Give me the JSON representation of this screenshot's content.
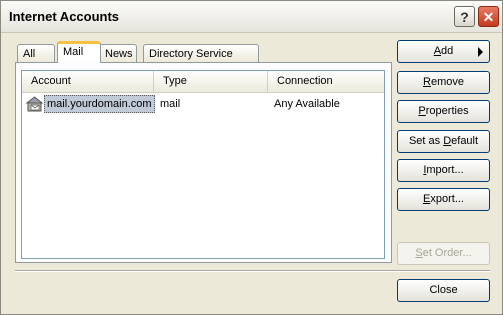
{
  "window": {
    "title": "Internet Accounts"
  },
  "titlebar": {
    "help_glyph": "?",
    "close_glyph": "✕"
  },
  "tabs": [
    {
      "label": "All"
    },
    {
      "label": "Mail",
      "active": true
    },
    {
      "label": "News"
    },
    {
      "label": "Directory Service"
    }
  ],
  "list": {
    "columns": [
      "Account",
      "Type",
      "Connection"
    ],
    "rows": [
      {
        "account": "mail.yourdomain.com",
        "type": "mail",
        "connection": "Any Available",
        "icon": "mail-account-icon"
      }
    ]
  },
  "buttons": {
    "add": {
      "mnemonic": "A",
      "rest": "dd"
    },
    "remove": {
      "mnemonic": "R",
      "rest": "emove"
    },
    "properties": {
      "mnemonic": "P",
      "rest": "roperties"
    },
    "set_default": {
      "before": "Set as ",
      "mnemonic": "D",
      "rest": "efault"
    },
    "import": {
      "mnemonic": "I",
      "rest": "mport..."
    },
    "export": {
      "mnemonic": "E",
      "rest": "xport..."
    },
    "set_order": {
      "mnemonic": "S",
      "rest": "et Order..."
    },
    "close": {
      "label": "Close"
    }
  },
  "colors": {
    "accent_tab": "#f6c243",
    "button_border": "#003c74",
    "selection": "#c1cbd8"
  }
}
